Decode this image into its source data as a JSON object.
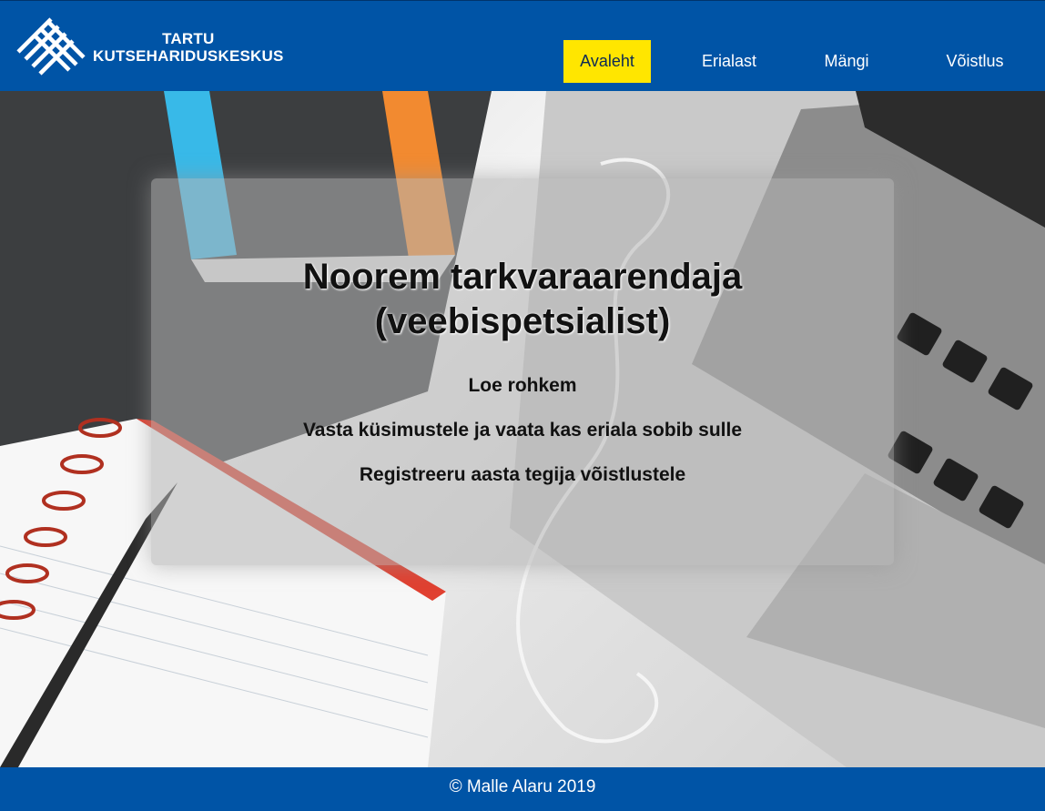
{
  "brand": {
    "line1": "TARTU",
    "line2": "KUTSEHARIDUSKESKUS",
    "accent": "#ffe600",
    "primary": "#0054a6"
  },
  "nav": [
    {
      "label": "Avaleht",
      "active": true
    },
    {
      "label": "Erialast",
      "active": false
    },
    {
      "label": "Mängi",
      "active": false
    },
    {
      "label": "Võistlus",
      "active": false
    }
  ],
  "hero": {
    "title_line1": "Noorem tarkvaraarendaja",
    "title_line2": "(veebispetsialist)",
    "links": [
      "Loe rohkem",
      "Vasta küsimustele ja vaata kas eriala sobib sulle",
      "Registreeru aasta tegija võistlustele"
    ]
  },
  "footer": {
    "text": "© Malle Alaru 2019"
  }
}
